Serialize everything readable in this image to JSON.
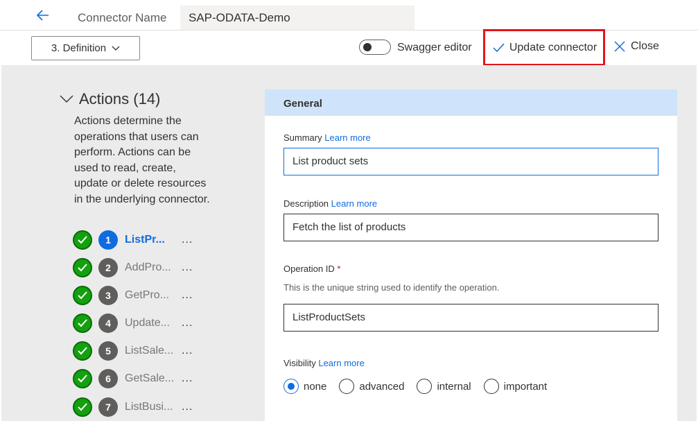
{
  "header": {
    "connector_name_label": "Connector Name",
    "connector_name_value": "SAP-ODATA-Demo"
  },
  "toolbar": {
    "step_label": "3. Definition",
    "swagger_label": "Swagger editor",
    "swagger_enabled": false,
    "update_label": "Update connector",
    "close_label": "Close"
  },
  "actions": {
    "title": "Actions (14)",
    "description": "Actions determine the operations that users can perform. Actions can be used to read, create, update or delete resources in the underlying connector.",
    "items": [
      {
        "number": "1",
        "name": "ListPr...",
        "active": true
      },
      {
        "number": "2",
        "name": "AddPro...",
        "active": false
      },
      {
        "number": "3",
        "name": "GetPro...",
        "active": false
      },
      {
        "number": "4",
        "name": "Update...",
        "active": false
      },
      {
        "number": "5",
        "name": "ListSale...",
        "active": false
      },
      {
        "number": "6",
        "name": "GetSale...",
        "active": false
      },
      {
        "number": "7",
        "name": "ListBusi...",
        "active": false
      }
    ],
    "more_label": "..."
  },
  "general": {
    "section_title": "General",
    "summary_label": "Summary",
    "summary_link": "Learn more",
    "summary_value": "List product sets",
    "description_label": "Description",
    "description_link": "Learn more",
    "description_value": "Fetch the list of products",
    "operation_id_label": "Operation ID",
    "operation_id_required": "*",
    "operation_id_hint": "This is the unique string used to identify the operation.",
    "operation_id_value": "ListProductSets",
    "visibility_label": "Visibility",
    "visibility_link": "Learn more",
    "visibility_options": [
      "none",
      "advanced",
      "internal",
      "important"
    ],
    "visibility_selected": "none"
  },
  "colors": {
    "accent": "#0f6cde",
    "success": "#13a10e",
    "highlight_box": "#e3151b",
    "section_header": "#cfe4fa"
  }
}
